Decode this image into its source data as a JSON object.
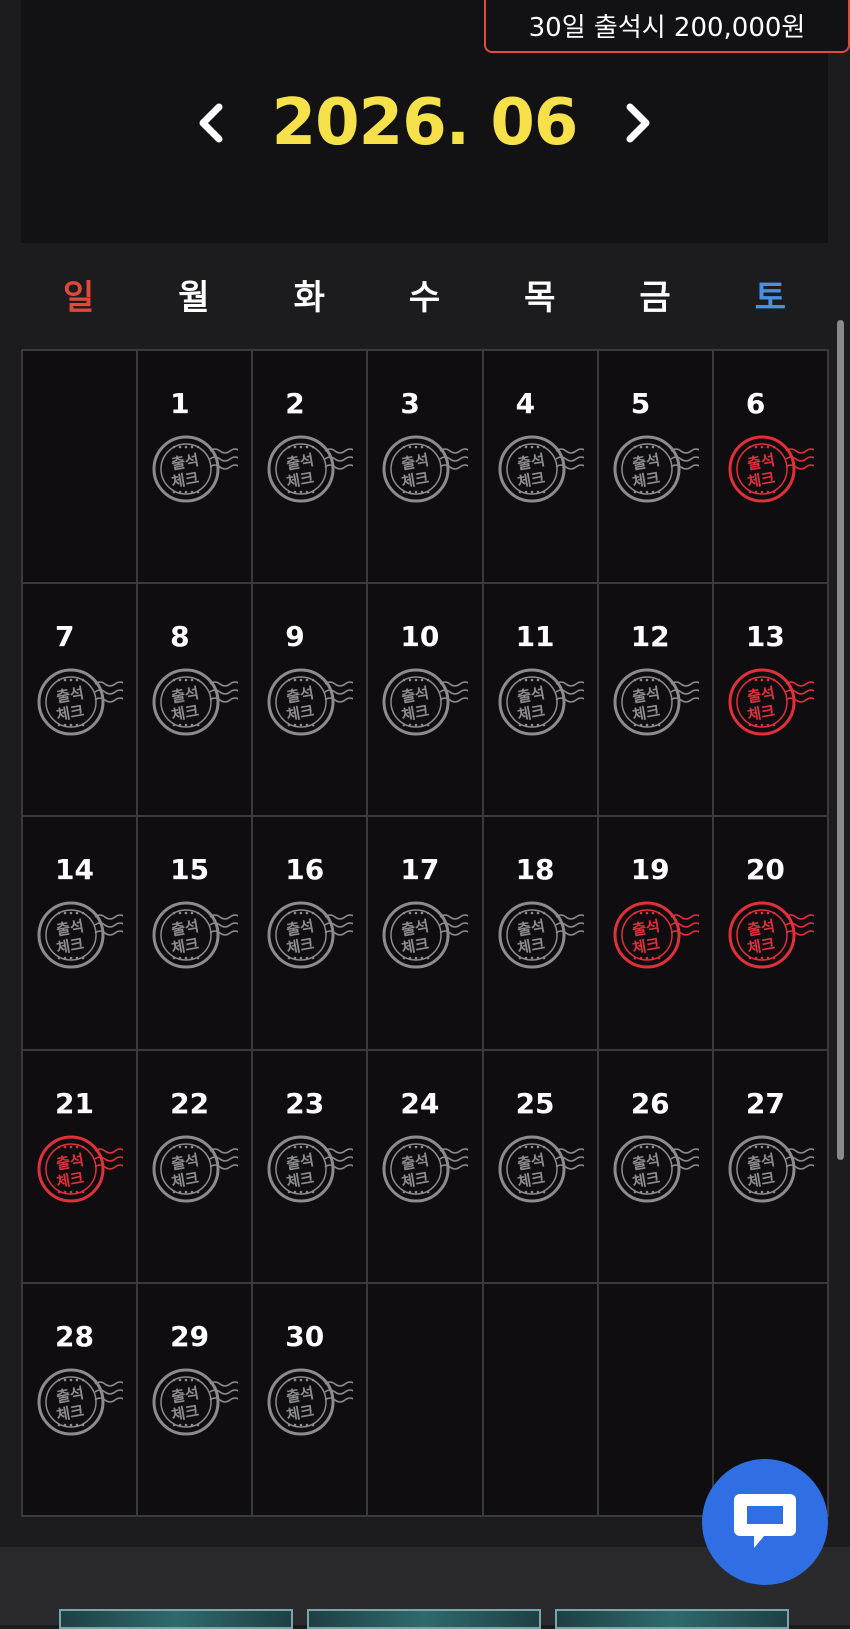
{
  "reward": {
    "text": "30일 출석시 200,000원"
  },
  "calendar": {
    "month_label": "2026. 06",
    "weekdays": [
      "일",
      "월",
      "화",
      "수",
      "목",
      "금",
      "토"
    ],
    "stamp_text": [
      "출석",
      "체크"
    ],
    "cells": [
      {
        "day": "",
        "checked": null
      },
      {
        "day": "1",
        "checked": false
      },
      {
        "day": "2",
        "checked": false
      },
      {
        "day": "3",
        "checked": false
      },
      {
        "day": "4",
        "checked": false
      },
      {
        "day": "5",
        "checked": false
      },
      {
        "day": "6",
        "checked": true
      },
      {
        "day": "7",
        "checked": false
      },
      {
        "day": "8",
        "checked": false
      },
      {
        "day": "9",
        "checked": false
      },
      {
        "day": "10",
        "checked": false
      },
      {
        "day": "11",
        "checked": false
      },
      {
        "day": "12",
        "checked": false
      },
      {
        "day": "13",
        "checked": true
      },
      {
        "day": "14",
        "checked": false
      },
      {
        "day": "15",
        "checked": false
      },
      {
        "day": "16",
        "checked": false
      },
      {
        "day": "17",
        "checked": false
      },
      {
        "day": "18",
        "checked": false
      },
      {
        "day": "19",
        "checked": true
      },
      {
        "day": "20",
        "checked": true
      },
      {
        "day": "21",
        "checked": true
      },
      {
        "day": "22",
        "checked": false
      },
      {
        "day": "23",
        "checked": false
      },
      {
        "day": "24",
        "checked": false
      },
      {
        "day": "25",
        "checked": false
      },
      {
        "day": "26",
        "checked": false
      },
      {
        "day": "27",
        "checked": false
      },
      {
        "day": "28",
        "checked": false
      },
      {
        "day": "29",
        "checked": false
      },
      {
        "day": "30",
        "checked": false
      },
      {
        "day": "",
        "checked": null
      },
      {
        "day": "",
        "checked": null
      },
      {
        "day": "",
        "checked": null
      },
      {
        "day": "",
        "checked": null
      }
    ]
  },
  "icons": {
    "prev": "chevron-left-icon",
    "next": "chevron-right-icon",
    "chat": "chat-bubble-icon",
    "stamp": "attendance-stamp-icon"
  },
  "colors": {
    "month": "#f7e14a",
    "sunday": "#e0483a",
    "saturday": "#4a8fe0",
    "stamp_checked": "#e0303a",
    "stamp_unchecked": "#8c8c8c",
    "chat_button": "#2f6fe3",
    "badge_border": "#e14b3b"
  }
}
